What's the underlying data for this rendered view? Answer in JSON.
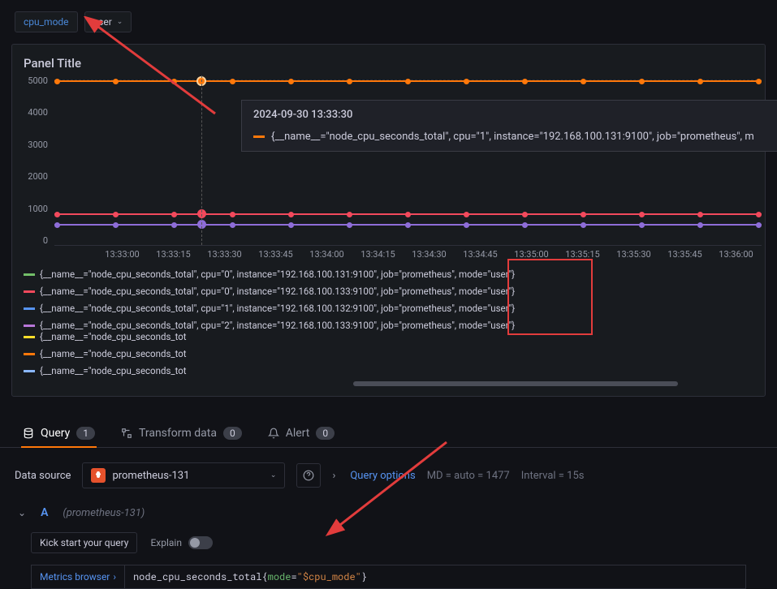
{
  "variable": {
    "name": "cpu_mode",
    "value": "user"
  },
  "panel": {
    "title": "Panel Title",
    "yTicks": [
      "5000",
      "4000",
      "3000",
      "2000",
      "1000",
      "0"
    ],
    "xTicks": [
      "13:33:00",
      "13:33:15",
      "13:33:30",
      "13:33:45",
      "13:34:00",
      "13:34:15",
      "13:34:30",
      "13:34:45",
      "13:35:00",
      "13:35:15",
      "13:35:30",
      "13:35:45",
      "13:36:00"
    ],
    "tooltip": {
      "timestamp": "2024-09-30 13:33:30",
      "color": "#ff780a",
      "text": "{__name__=\"node_cpu_seconds_total\", cpu=\"1\", instance=\"192.168.100.131:9100\", job=\"prometheus\", m"
    },
    "legend": {
      "left": [
        {
          "color": "#73bf69",
          "text": "{__name__=\"node_cpu_seconds_total\", cpu=\"0\", instance=\"192.168.100.131:9100\", job=\"prometheus\", mode=\"user\"}"
        },
        {
          "color": "#f2495c",
          "text": "{__name__=\"node_cpu_seconds_total\", cpu=\"0\", instance=\"192.168.100.133:9100\", job=\"prometheus\", mode=\"user\"}"
        },
        {
          "color": "#5794f2",
          "text": "{__name__=\"node_cpu_seconds_total\", cpu=\"1\", instance=\"192.168.100.132:9100\", job=\"prometheus\", mode=\"user\"}"
        },
        {
          "color": "#b877d9",
          "text": "{__name__=\"node_cpu_seconds_total\", cpu=\"2\", instance=\"192.168.100.133:9100\", job=\"prometheus\", mode=\"user\"}"
        }
      ],
      "right": [
        {
          "color": "#fade2a",
          "text": "{__name__=\"node_cpu_seconds_tot"
        },
        {
          "color": "#ff780a",
          "text": "{__name__=\"node_cpu_seconds_tot"
        },
        {
          "color": "#8ab8ff",
          "text": "{__name__=\"node_cpu_seconds_tot"
        }
      ]
    }
  },
  "tabs": {
    "query": {
      "label": "Query",
      "count": "1"
    },
    "transform": {
      "label": "Transform data",
      "count": "0"
    },
    "alert": {
      "label": "Alert",
      "count": "0"
    }
  },
  "datasource": {
    "label": "Data source",
    "name": "prometheus-131",
    "queryOptions": "Query options",
    "md": "MD = auto = 1477",
    "interval": "Interval = 15s"
  },
  "query": {
    "letter": "A",
    "dsName": "(prometheus-131)",
    "kickstart": "Kick start your query",
    "explain": "Explain",
    "metricsBrowser": "Metrics browser",
    "expr_prefix": "node_cpu_seconds_total{",
    "expr_label": "mode",
    "expr_eq": "=",
    "expr_value": "\"$cpu_mode\"",
    "expr_suffix": "}"
  },
  "chart_data": {
    "type": "line",
    "title": "Panel Title",
    "xlabel": "",
    "ylabel": "",
    "ylim": [
      0,
      5500
    ],
    "x": [
      "13:33:00",
      "13:33:15",
      "13:33:30",
      "13:33:45",
      "13:34:00",
      "13:34:15",
      "13:34:30",
      "13:34:45",
      "13:35:00",
      "13:35:15",
      "13:35:30",
      "13:35:45",
      "13:36:00"
    ],
    "series": [
      {
        "name": "cpu=1 instance=192.168.100.131:9100 mode=user",
        "color": "#ff780a",
        "values": [
          5300,
          5300,
          5300,
          5300,
          5300,
          5300,
          5300,
          5300,
          5300,
          5300,
          5300,
          5300,
          5300
        ]
      },
      {
        "name": "cpu=0 instance=192.168.100.133:9100 mode=user",
        "color": "#f2495c",
        "values": [
          950,
          950,
          950,
          950,
          950,
          950,
          950,
          950,
          950,
          950,
          950,
          950,
          950
        ]
      },
      {
        "name": "cpu=1 instance=192.168.100.132:9100 mode=user",
        "color": "#5794f2",
        "values": [
          650,
          650,
          650,
          650,
          650,
          650,
          650,
          650,
          650,
          650,
          650,
          650,
          650
        ]
      },
      {
        "name": "cpu=0 instance=192.168.100.131:9100 mode=user",
        "color": "#73bf69",
        "values": [
          950,
          950,
          950,
          950,
          950,
          950,
          950,
          950,
          950,
          950,
          950,
          950,
          950
        ]
      }
    ]
  }
}
